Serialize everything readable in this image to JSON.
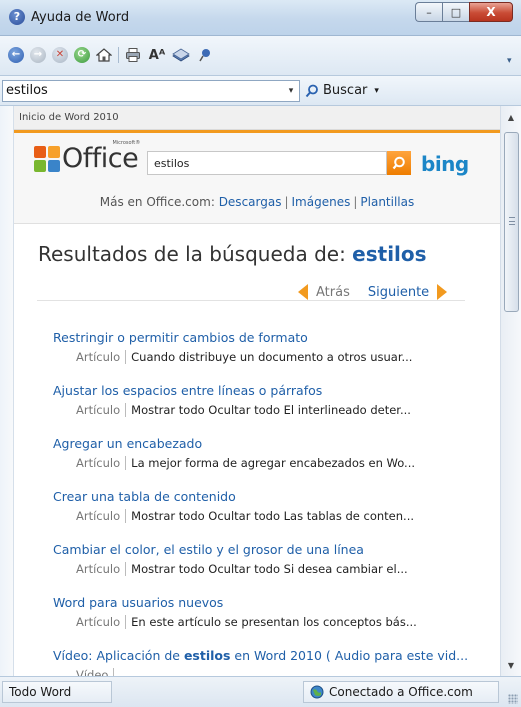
{
  "window": {
    "title": "Ayuda de Word",
    "app_icon_glyph": "?",
    "buttons": {
      "minimize": "–",
      "maximize": "□",
      "close": "X"
    }
  },
  "toolbar": {
    "icons": [
      "back-icon",
      "forward-icon",
      "stop-icon",
      "refresh-icon",
      "home-icon",
      "print-icon",
      "text-size-icon",
      "toc-book-icon",
      "keep-on-top-pin-icon"
    ],
    "text_size_glyph": "Aᴬ",
    "overflow_glyph": "▾"
  },
  "search_bar": {
    "value": "estilos",
    "dropdown_glyph": "▾",
    "search_button_label": "Buscar",
    "search_button_arrow": "▾"
  },
  "content": {
    "breadcrumb": "Inicio de Word 2010",
    "header": {
      "office_logo_text": "Office",
      "office_logo_super": "Microsoft®",
      "search_value": "estilos",
      "bing_label": "bing",
      "more_prefix": "Más en Office.com:",
      "more_links": [
        "Descargas",
        "Imágenes",
        "Plantillas"
      ],
      "separator": "|"
    },
    "results_heading_prefix": "Resultados de la búsqueda de:",
    "results_query": "estilos",
    "pager": {
      "prev": "Atrás",
      "next": "Siguiente"
    },
    "results": [
      {
        "title": "Restringir o permitir cambios de formato",
        "type": "Artículo",
        "snippet": "Cuando distribuye un documento a otros usuar..."
      },
      {
        "title": "Ajustar los espacios entre líneas o párrafos",
        "type": "Artículo",
        "snippet": "Mostrar todo Ocultar todo El interlineado deter..."
      },
      {
        "title": "Agregar un encabezado",
        "type": "Artículo",
        "snippet": "La mejor forma de agregar encabezados en Wo..."
      },
      {
        "title": "Crear una tabla de contenido",
        "type": "Artículo",
        "snippet": "Mostrar todo Ocultar todo Las tablas de conten..."
      },
      {
        "title": "Cambiar el color, el estilo y el grosor de una línea",
        "type": "Artículo",
        "snippet": "Mostrar todo Ocultar todo Si desea cambiar el..."
      },
      {
        "title": "Word para usuarios nuevos",
        "type": "Artículo",
        "snippet": "En este artículo se presentan los conceptos bás..."
      },
      {
        "title_pre": "Vídeo: Aplicación de ",
        "title_bold": "estilos",
        "title_post": " en Word 2010 ( Audio para este vid...",
        "type": "Vídeo",
        "snippet": ""
      }
    ]
  },
  "scrollbar": {
    "up_glyph": "▲",
    "down_glyph": "▼"
  },
  "statusbar": {
    "scope": "Todo Word",
    "connection": "Conectado a Office.com"
  },
  "colors": {
    "link": "#1f5fa8",
    "accent_orange": "#f29a1f",
    "bing_blue": "#1c86c7",
    "office_squares": [
      "#e85e16",
      "#f7a12b",
      "#79b72f",
      "#3a84c9"
    ]
  }
}
